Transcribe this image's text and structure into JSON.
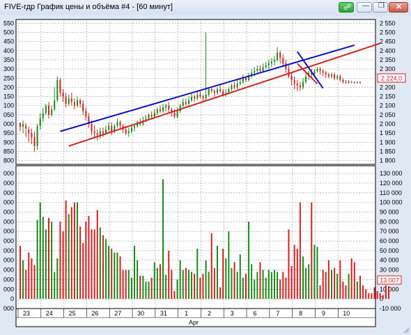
{
  "window": {
    "title": "FIVE-гдр График цены и объёма #4 - [60 минут]",
    "link_icon": "link-icon",
    "min_icon": "minimize-icon",
    "max_icon": "restore-icon",
    "close_icon": "close-icon"
  },
  "colors": {
    "up": "#1a8a1a",
    "down": "#d42020",
    "blue_line": "#1010c8",
    "red_line": "#d42020",
    "grid": "#9a9a9a"
  },
  "price_panel": {
    "left_ticks": [
      "550",
      "500",
      "450",
      "400",
      "350",
      "300",
      "250",
      "200",
      "150",
      "100",
      "050",
      "000",
      "950",
      "900",
      "850",
      "800"
    ],
    "right_ticks": [
      "2 550",
      "2 500",
      "2 450",
      "2 400",
      "2 350",
      "2 300",
      "2 250",
      "2 200",
      "2 150",
      "2 100",
      "2 050",
      "2 000",
      "1 950",
      "1 900",
      "1 850",
      "1 800"
    ],
    "current_price_label": "2 224,0"
  },
  "volume_panel": {
    "left_ticks": [
      "000",
      "000",
      "000",
      "000",
      "000",
      "000",
      "000",
      "000",
      "000",
      "000",
      "000",
      "000",
      "000",
      "0",
      "000"
    ],
    "right_ticks": [
      "130 000",
      "120 000",
      "110 000",
      "100 000",
      "90 000",
      "80 000",
      "70 000",
      "60 000",
      "50 000",
      "40 000",
      "30 000",
      "20 000",
      "10 000",
      "0",
      "-10 000"
    ],
    "current_volume_label": "13 007"
  },
  "x_axis": {
    "day_labels": [
      "23",
      "24",
      "25",
      "26",
      "27",
      "30",
      "31",
      "1",
      "2",
      "3",
      "6",
      "7",
      "8",
      "9",
      "10"
    ],
    "month_label": "Apr"
  },
  "chart_data": {
    "type": "candlestick-volume",
    "price_range": [
      1780,
      2570
    ],
    "volume_range": [
      -10000,
      138000
    ],
    "candles": [
      {
        "o": 2005,
        "c": 1985,
        "h": 2010,
        "l": 1960
      },
      {
        "o": 1985,
        "c": 2000,
        "h": 2020,
        "l": 1950
      },
      {
        "o": 1990,
        "c": 1975,
        "h": 2005,
        "l": 1930
      },
      {
        "o": 1970,
        "c": 1950,
        "h": 1985,
        "l": 1900
      },
      {
        "o": 1950,
        "c": 1925,
        "h": 1975,
        "l": 1890
      },
      {
        "o": 1930,
        "c": 1880,
        "h": 1960,
        "l": 1850
      },
      {
        "o": 1880,
        "c": 1990,
        "h": 2000,
        "l": 1860
      },
      {
        "o": 1990,
        "c": 2030,
        "h": 2060,
        "l": 1970
      },
      {
        "o": 2030,
        "c": 2060,
        "h": 2090,
        "l": 2010
      },
      {
        "o": 2060,
        "c": 2100,
        "h": 2110,
        "l": 2050
      },
      {
        "o": 2100,
        "c": 2050,
        "h": 2120,
        "l": 2030
      },
      {
        "o": 2050,
        "c": 2080,
        "h": 2100,
        "l": 2040
      },
      {
        "o": 2080,
        "c": 2130,
        "h": 2200,
        "l": 2070
      },
      {
        "o": 2130,
        "c": 2240,
        "h": 2260,
        "l": 2120
      },
      {
        "o": 2240,
        "c": 2170,
        "h": 2250,
        "l": 2150
      },
      {
        "o": 2170,
        "c": 2150,
        "h": 2190,
        "l": 2120
      },
      {
        "o": 2150,
        "c": 2110,
        "h": 2170,
        "l": 2090
      },
      {
        "o": 2110,
        "c": 2140,
        "h": 2160,
        "l": 2100
      },
      {
        "o": 2140,
        "c": 2120,
        "h": 2170,
        "l": 2100
      },
      {
        "o": 2120,
        "c": 2100,
        "h": 2140,
        "l": 2080
      },
      {
        "o": 2100,
        "c": 2130,
        "h": 2150,
        "l": 2090
      },
      {
        "o": 2130,
        "c": 2110,
        "h": 2140,
        "l": 2090
      },
      {
        "o": 2110,
        "c": 2070,
        "h": 2130,
        "l": 2050
      },
      {
        "o": 2070,
        "c": 2040,
        "h": 2090,
        "l": 2020
      },
      {
        "o": 2040,
        "c": 2000,
        "h": 2060,
        "l": 1980
      },
      {
        "o": 2000,
        "c": 1960,
        "h": 2020,
        "l": 1940
      },
      {
        "o": 1960,
        "c": 1950,
        "h": 1990,
        "l": 1920
      },
      {
        "o": 1950,
        "c": 1940,
        "h": 1970,
        "l": 1910
      },
      {
        "o": 1940,
        "c": 1960,
        "h": 1980,
        "l": 1920
      },
      {
        "o": 1960,
        "c": 1950,
        "h": 1980,
        "l": 1930
      },
      {
        "o": 1950,
        "c": 1970,
        "h": 1990,
        "l": 1940
      },
      {
        "o": 1970,
        "c": 1990,
        "h": 2010,
        "l": 1950
      },
      {
        "o": 1990,
        "c": 1960,
        "h": 2010,
        "l": 1940
      },
      {
        "o": 1960,
        "c": 1990,
        "h": 2000,
        "l": 1950
      },
      {
        "o": 1990,
        "c": 2010,
        "h": 2030,
        "l": 1980
      },
      {
        "o": 2010,
        "c": 1990,
        "h": 2020,
        "l": 1970
      },
      {
        "o": 1990,
        "c": 1970,
        "h": 2000,
        "l": 1950
      },
      {
        "o": 1970,
        "c": 1950,
        "h": 1990,
        "l": 1940
      },
      {
        "o": 1950,
        "c": 1960,
        "h": 1980,
        "l": 1930
      },
      {
        "o": 1960,
        "c": 1980,
        "h": 1990,
        "l": 1950
      },
      {
        "o": 1980,
        "c": 1990,
        "h": 2000,
        "l": 1960
      },
      {
        "o": 1990,
        "c": 2010,
        "h": 2020,
        "l": 1980
      },
      {
        "o": 2010,
        "c": 2000,
        "h": 2030,
        "l": 1990
      },
      {
        "o": 2000,
        "c": 2020,
        "h": 2040,
        "l": 1990
      },
      {
        "o": 2020,
        "c": 2030,
        "h": 2050,
        "l": 2010
      },
      {
        "o": 2030,
        "c": 2050,
        "h": 2060,
        "l": 2020
      },
      {
        "o": 2050,
        "c": 2040,
        "h": 2070,
        "l": 2030
      },
      {
        "o": 2040,
        "c": 2060,
        "h": 2080,
        "l": 2030
      },
      {
        "o": 2060,
        "c": 2080,
        "h": 2090,
        "l": 2050
      },
      {
        "o": 2080,
        "c": 2070,
        "h": 2100,
        "l": 2060
      },
      {
        "o": 2070,
        "c": 2090,
        "h": 2110,
        "l": 2060
      },
      {
        "o": 2090,
        "c": 2100,
        "h": 2110,
        "l": 2070
      },
      {
        "o": 2100,
        "c": 2080,
        "h": 2120,
        "l": 2060
      },
      {
        "o": 2080,
        "c": 2060,
        "h": 2090,
        "l": 2040
      },
      {
        "o": 2060,
        "c": 2040,
        "h": 2080,
        "l": 2030
      },
      {
        "o": 2040,
        "c": 2070,
        "h": 2090,
        "l": 2030
      },
      {
        "o": 2070,
        "c": 2100,
        "h": 2110,
        "l": 2060
      },
      {
        "o": 2100,
        "c": 2120,
        "h": 2140,
        "l": 2090
      },
      {
        "o": 2120,
        "c": 2110,
        "h": 2140,
        "l": 2100
      },
      {
        "o": 2110,
        "c": 2130,
        "h": 2150,
        "l": 2100
      },
      {
        "o": 2130,
        "c": 2150,
        "h": 2170,
        "l": 2120
      },
      {
        "o": 2150,
        "c": 2140,
        "h": 2160,
        "l": 2120
      },
      {
        "o": 2140,
        "c": 2160,
        "h": 2180,
        "l": 2130
      },
      {
        "o": 2160,
        "c": 2150,
        "h": 2180,
        "l": 2140
      },
      {
        "o": 2150,
        "c": 2140,
        "h": 2160,
        "l": 2120
      },
      {
        "o": 2140,
        "c": 2160,
        "h": 2500,
        "l": 2130
      },
      {
        "o": 2160,
        "c": 2190,
        "h": 2200,
        "l": 2150
      },
      {
        "o": 2190,
        "c": 2180,
        "h": 2200,
        "l": 2170
      },
      {
        "o": 2180,
        "c": 2170,
        "h": 2190,
        "l": 2150
      },
      {
        "o": 2170,
        "c": 2190,
        "h": 2200,
        "l": 2160
      },
      {
        "o": 2190,
        "c": 2180,
        "h": 2210,
        "l": 2170
      },
      {
        "o": 2180,
        "c": 2160,
        "h": 2190,
        "l": 2150
      },
      {
        "o": 2160,
        "c": 2170,
        "h": 2190,
        "l": 2150
      },
      {
        "o": 2170,
        "c": 2190,
        "h": 2200,
        "l": 2160
      },
      {
        "o": 2190,
        "c": 2210,
        "h": 2220,
        "l": 2180
      },
      {
        "o": 2210,
        "c": 2200,
        "h": 2230,
        "l": 2190
      },
      {
        "o": 2200,
        "c": 2220,
        "h": 2240,
        "l": 2190
      },
      {
        "o": 2220,
        "c": 2230,
        "h": 2250,
        "l": 2210
      },
      {
        "o": 2230,
        "c": 2250,
        "h": 2270,
        "l": 2220
      },
      {
        "o": 2250,
        "c": 2240,
        "h": 2260,
        "l": 2230
      },
      {
        "o": 2240,
        "c": 2260,
        "h": 2280,
        "l": 2230
      },
      {
        "o": 2260,
        "c": 2280,
        "h": 2300,
        "l": 2250
      },
      {
        "o": 2280,
        "c": 2290,
        "h": 2310,
        "l": 2260
      },
      {
        "o": 2290,
        "c": 2300,
        "h": 2320,
        "l": 2280
      },
      {
        "o": 2300,
        "c": 2290,
        "h": 2320,
        "l": 2280
      },
      {
        "o": 2290,
        "c": 2310,
        "h": 2330,
        "l": 2280
      },
      {
        "o": 2310,
        "c": 2320,
        "h": 2340,
        "l": 2300
      },
      {
        "o": 2320,
        "c": 2330,
        "h": 2350,
        "l": 2300
      },
      {
        "o": 2330,
        "c": 2340,
        "h": 2360,
        "l": 2310
      },
      {
        "o": 2340,
        "c": 2350,
        "h": 2370,
        "l": 2320
      },
      {
        "o": 2350,
        "c": 2390,
        "h": 2420,
        "l": 2340
      },
      {
        "o": 2390,
        "c": 2360,
        "h": 2400,
        "l": 2330
      },
      {
        "o": 2360,
        "c": 2330,
        "h": 2380,
        "l": 2310
      },
      {
        "o": 2330,
        "c": 2300,
        "h": 2350,
        "l": 2280
      },
      {
        "o": 2300,
        "c": 2260,
        "h": 2320,
        "l": 2250
      },
      {
        "o": 2260,
        "c": 2240,
        "h": 2280,
        "l": 2210
      },
      {
        "o": 2240,
        "c": 2220,
        "h": 2260,
        "l": 2190
      },
      {
        "o": 2220,
        "c": 2210,
        "h": 2240,
        "l": 2180
      },
      {
        "o": 2210,
        "c": 2200,
        "h": 2230,
        "l": 2180
      },
      {
        "o": 2200,
        "c": 2230,
        "h": 2250,
        "l": 2190
      },
      {
        "o": 2230,
        "c": 2260,
        "h": 2280,
        "l": 2220
      },
      {
        "o": 2260,
        "c": 2280,
        "h": 2290,
        "l": 2240
      },
      {
        "o": 2280,
        "c": 2270,
        "h": 2300,
        "l": 2250
      },
      {
        "o": 2270,
        "c": 2290,
        "h": 2300,
        "l": 2260
      },
      {
        "o": 2290,
        "c": 2300,
        "h": 2310,
        "l": 2280
      },
      {
        "o": 2300,
        "c": 2290,
        "h": 2310,
        "l": 2270
      },
      {
        "o": 2290,
        "c": 2280,
        "h": 2300,
        "l": 2260
      },
      {
        "o": 2280,
        "c": 2270,
        "h": 2290,
        "l": 2250
      },
      {
        "o": 2270,
        "c": 2260,
        "h": 2280,
        "l": 2250
      },
      {
        "o": 2260,
        "c": 2270,
        "h": 2280,
        "l": 2250
      },
      {
        "o": 2270,
        "c": 2250,
        "h": 2280,
        "l": 2240
      },
      {
        "o": 2250,
        "c": 2260,
        "h": 2270,
        "l": 2240
      },
      {
        "o": 2260,
        "c": 2240,
        "h": 2270,
        "l": 2230
      },
      {
        "o": 2240,
        "c": 2230,
        "h": 2250,
        "l": 2220
      },
      {
        "o": 2230,
        "c": 2225,
        "h": 2240,
        "l": 2220
      },
      {
        "o": 2225,
        "c": 2230,
        "h": 2240,
        "l": 2220
      },
      {
        "o": 2230,
        "c": 2228,
        "h": 2235,
        "l": 2222
      },
      {
        "o": 2228,
        "c": 2226,
        "h": 2232,
        "l": 2220
      },
      {
        "o": 2226,
        "c": 2228,
        "h": 2232,
        "l": 2220
      },
      {
        "o": 2228,
        "c": 2224,
        "h": 2232,
        "l": 2220
      }
    ],
    "volumes": [
      55000,
      40000,
      30000,
      48000,
      42000,
      35000,
      82000,
      100000,
      85000,
      72000,
      84000,
      80000,
      28000,
      42000,
      80000,
      70000,
      102000,
      88000,
      95000,
      100000,
      100000,
      75000,
      58000,
      80000,
      86000,
      72000,
      72000,
      92000,
      74000,
      66000,
      62000,
      55000,
      52000,
      48000,
      48000,
      44000,
      30000,
      30000,
      30000,
      22000,
      55000,
      40000,
      24000,
      24000,
      18000,
      18000,
      22000,
      38000,
      32000,
      36000,
      124000,
      25000,
      50000,
      30000,
      8000,
      20000,
      40000,
      30000,
      32000,
      30000,
      28000,
      26000,
      52000,
      22000,
      26000,
      40000,
      28000,
      68000,
      32000,
      55000,
      12000,
      52000,
      42000,
      70000,
      32000,
      38000,
      28000,
      46000,
      22000,
      26000,
      80000,
      36000,
      20000,
      28000,
      38000,
      30000,
      22000,
      30000,
      28000,
      30000,
      28000,
      20000,
      28000,
      22000,
      72000,
      34000,
      56000,
      52000,
      100000,
      44000,
      32000,
      36000,
      100000,
      56000,
      54000,
      14000,
      30000,
      28000,
      40000,
      30000,
      32000,
      26000,
      40000,
      18000,
      14000,
      26000,
      42000,
      38000,
      18000,
      24000,
      14000,
      10000,
      6000,
      6000,
      12000,
      8000,
      6000,
      4000,
      14000,
      13007
    ],
    "trendlines": [
      {
        "color": "blue",
        "from": {
          "bar": 14,
          "price": 1960
        },
        "to": {
          "bar": 117,
          "price": 2430
        }
      },
      {
        "color": "red",
        "from": {
          "bar": 17,
          "price": 1880
        },
        "to": {
          "bar": 126,
          "price": 2440
        }
      },
      {
        "color": "blue",
        "from": {
          "bar": 97,
          "price": 2395
        },
        "to": {
          "bar": 106,
          "price": 2195
        }
      },
      {
        "color": "red",
        "from": {
          "bar": 97,
          "price": 2330
        },
        "to": {
          "bar": 104,
          "price": 2220
        }
      }
    ]
  }
}
